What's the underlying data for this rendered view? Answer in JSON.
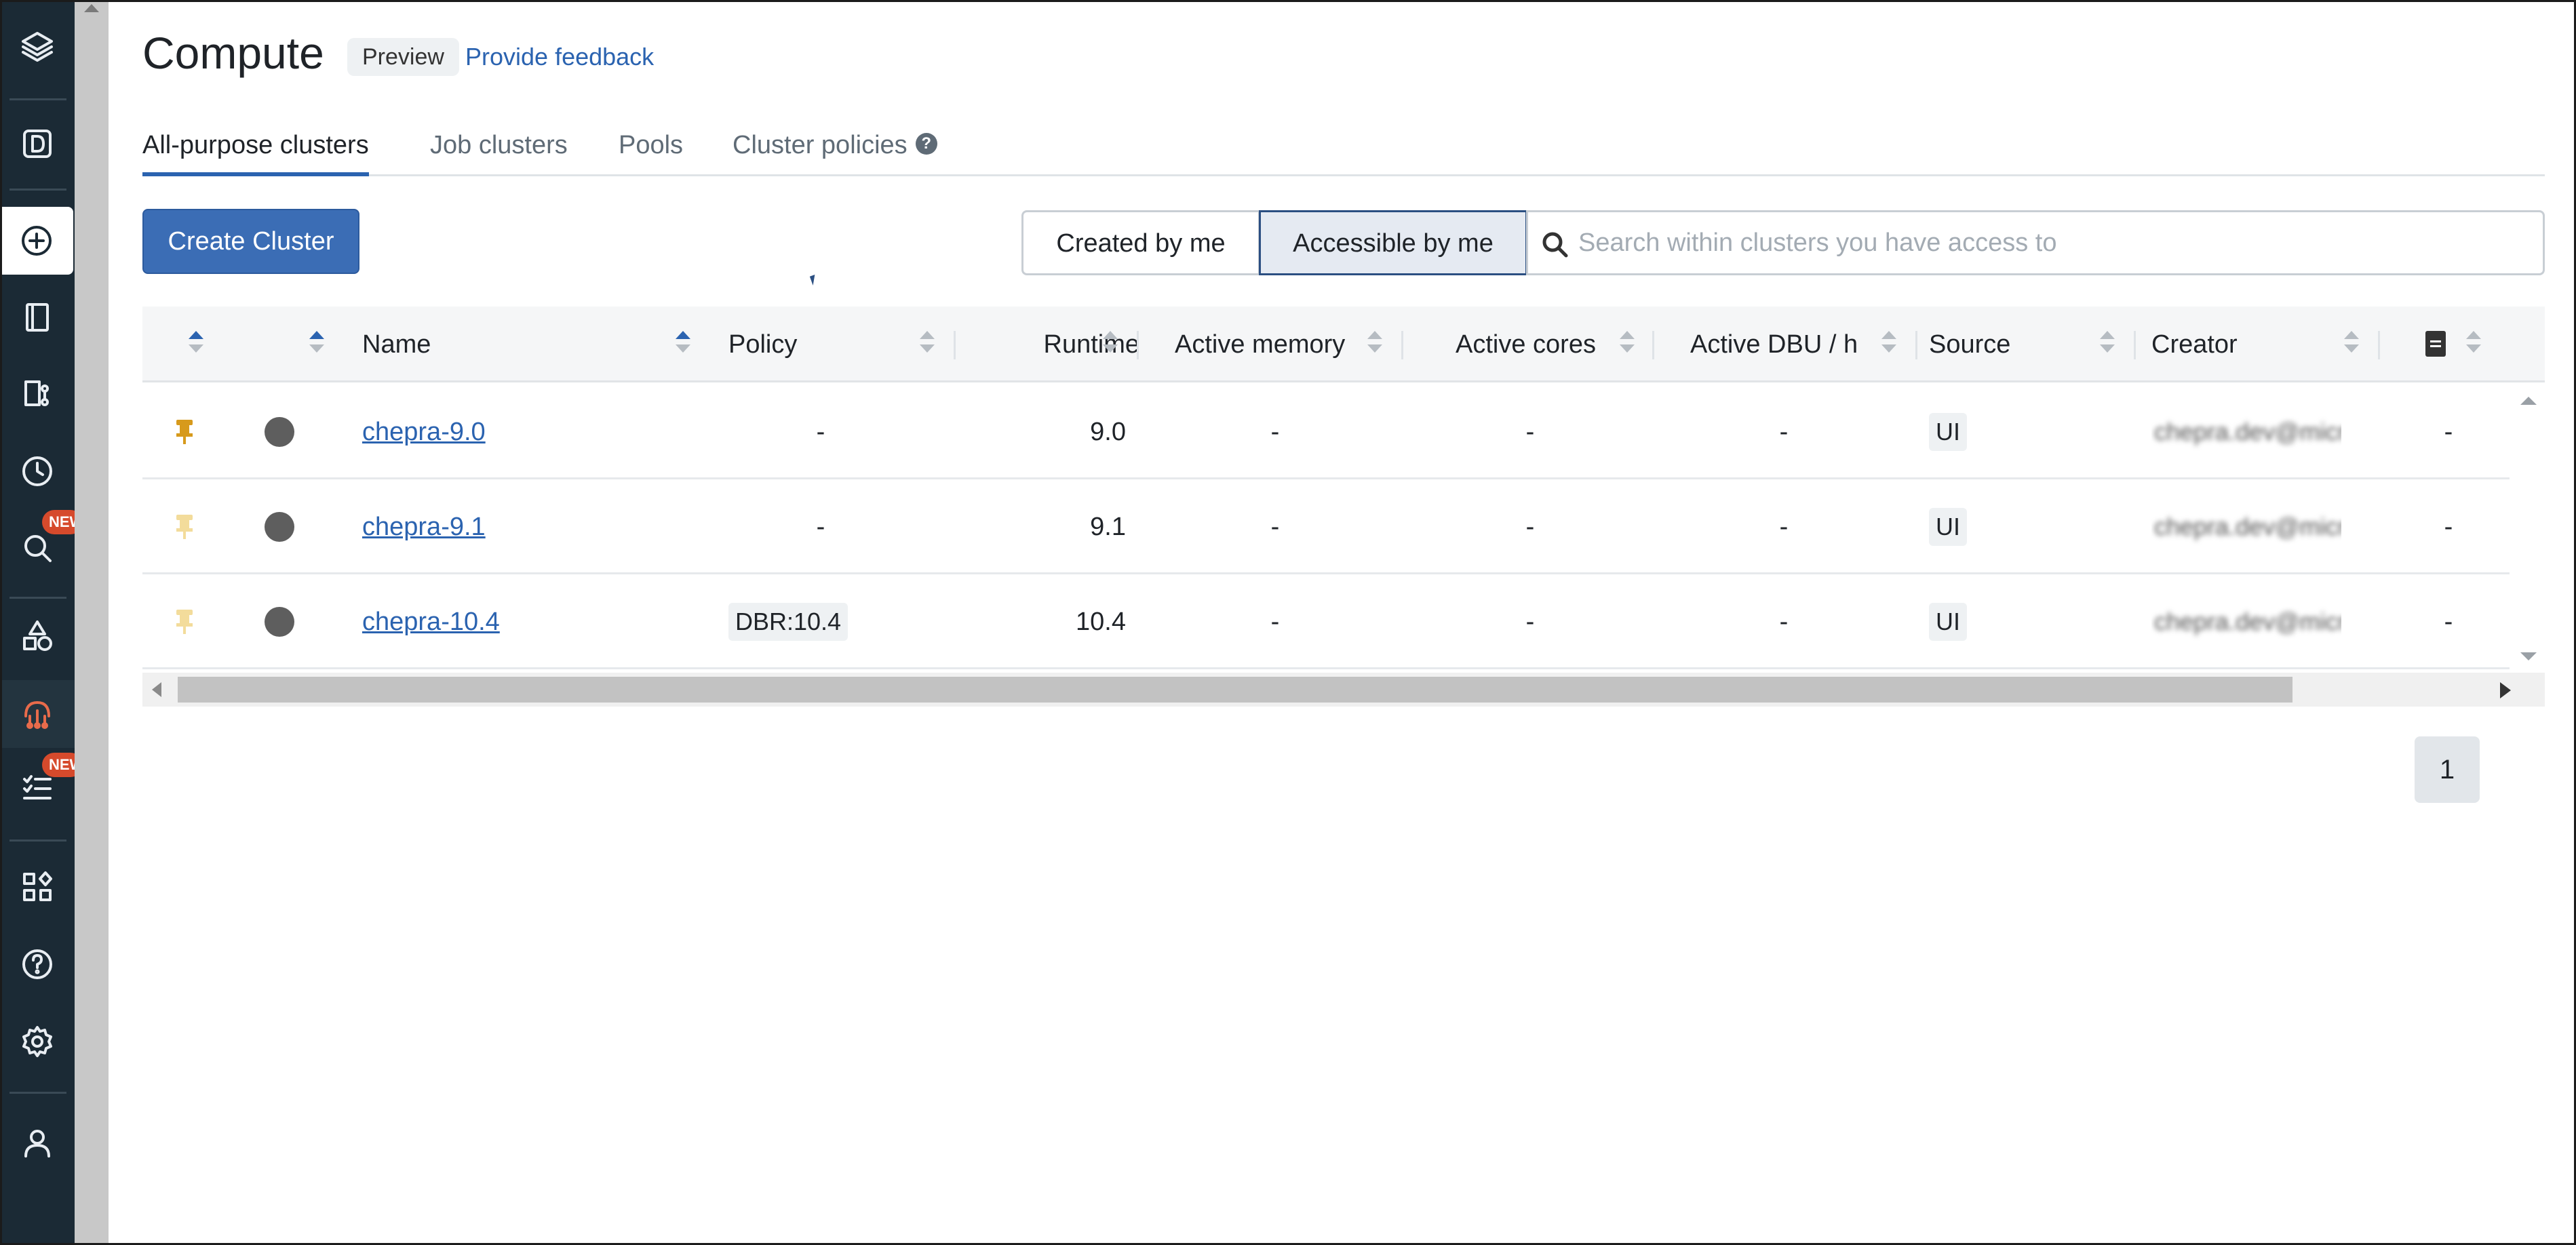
{
  "nav": {
    "workspace_letter": "D",
    "new_badge": "NEW",
    "items": [
      "logo-icon",
      "workspace-switcher",
      "create-icon",
      "workspace-icon",
      "repos-icon",
      "recents-icon",
      "search-icon",
      "catalog-icon",
      "compute-icon",
      "workflows-icon",
      "marketplace-icon",
      "help-icon",
      "settings-icon",
      "user-icon"
    ]
  },
  "header": {
    "title": "Compute",
    "tag": "Preview",
    "feedback_link": "Provide feedback"
  },
  "tabs": [
    {
      "label": "All-purpose clusters",
      "active": true
    },
    {
      "label": "Job clusters",
      "active": false
    },
    {
      "label": "Pools",
      "active": false
    },
    {
      "label": "Cluster policies",
      "active": false
    }
  ],
  "toolbar": {
    "create_label": "Create Cluster",
    "filter_created": "Created by me",
    "filter_accessible": "Accessible by me",
    "search_placeholder": "Search within clusters you have access to"
  },
  "table": {
    "columns": [
      "",
      "",
      "Name",
      "Policy",
      "Runtime",
      "Active memory",
      "Active cores",
      "Active DBU / h",
      "Source",
      "Creator",
      ""
    ],
    "rows": [
      {
        "pinned": true,
        "name": "chepra-9.0",
        "policy": "-",
        "runtime": "9.0",
        "memory": "-",
        "cores": "-",
        "dbu": "-",
        "source": "UI",
        "creator": "chepra.dev@micro…",
        "last": "-"
      },
      {
        "pinned": false,
        "name": "chepra-9.1",
        "policy": "-",
        "runtime": "9.1",
        "memory": "-",
        "cores": "-",
        "dbu": "-",
        "source": "UI",
        "creator": "chepra.dev@micro…",
        "last": "-"
      },
      {
        "pinned": false,
        "name": "chepra-10.4",
        "policy": "DBR:10.4",
        "runtime": "10.4",
        "memory": "-",
        "cores": "-",
        "dbu": "-",
        "source": "UI",
        "creator": "chepra.dev@micro…",
        "last": "-"
      }
    ]
  },
  "pagination": {
    "current_page": "1"
  },
  "colors": {
    "accent": "#2b63b0",
    "button": "#3b6db5",
    "nav_bg": "#1b2a35",
    "active_nav": "#e86b4b",
    "pin": "#d79a1c"
  }
}
